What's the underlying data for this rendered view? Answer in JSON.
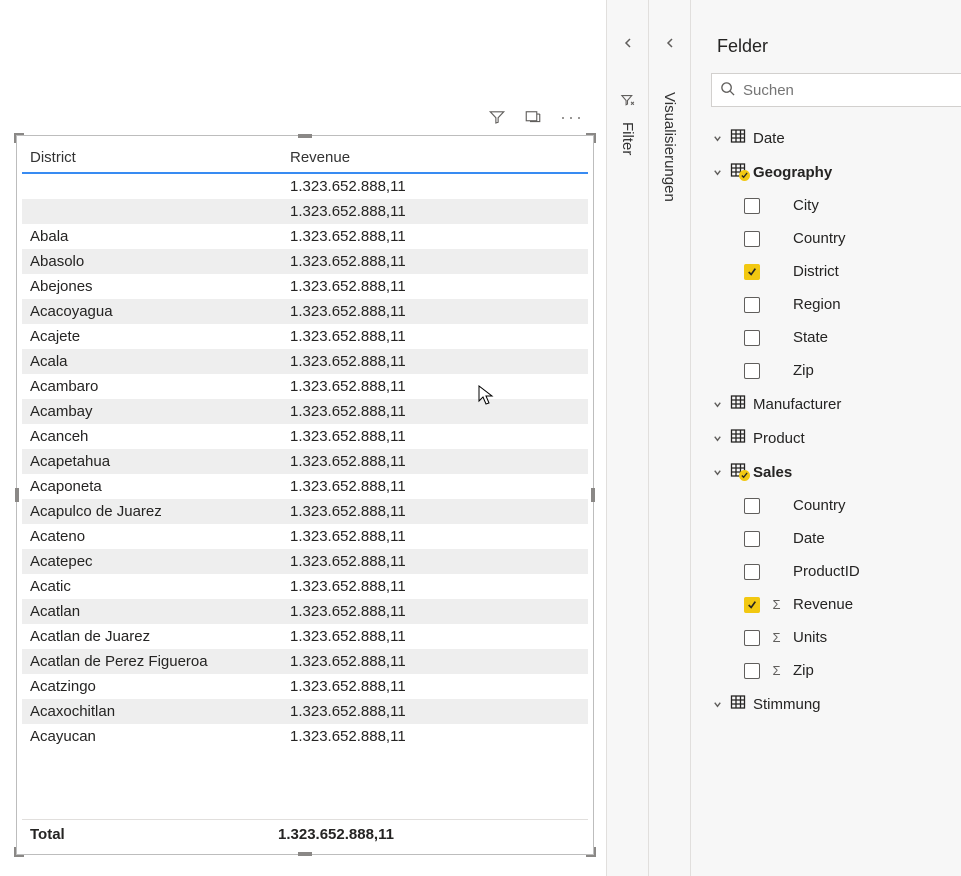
{
  "table": {
    "headers": {
      "district": "District",
      "revenue": "Revenue"
    },
    "rows": [
      {
        "district": "",
        "revenue": "1.323.652.888,11"
      },
      {
        "district": "",
        "revenue": "1.323.652.888,11"
      },
      {
        "district": "Abala",
        "revenue": "1.323.652.888,11"
      },
      {
        "district": "Abasolo",
        "revenue": "1.323.652.888,11"
      },
      {
        "district": "Abejones",
        "revenue": "1.323.652.888,11"
      },
      {
        "district": "Acacoyagua",
        "revenue": "1.323.652.888,11"
      },
      {
        "district": "Acajete",
        "revenue": "1.323.652.888,11"
      },
      {
        "district": "Acala",
        "revenue": "1.323.652.888,11"
      },
      {
        "district": "Acambaro",
        "revenue": "1.323.652.888,11"
      },
      {
        "district": "Acambay",
        "revenue": "1.323.652.888,11"
      },
      {
        "district": "Acanceh",
        "revenue": "1.323.652.888,11"
      },
      {
        "district": "Acapetahua",
        "revenue": "1.323.652.888,11"
      },
      {
        "district": "Acaponeta",
        "revenue": "1.323.652.888,11"
      },
      {
        "district": "Acapulco de Juarez",
        "revenue": "1.323.652.888,11"
      },
      {
        "district": "Acateno",
        "revenue": "1.323.652.888,11"
      },
      {
        "district": "Acatepec",
        "revenue": "1.323.652.888,11"
      },
      {
        "district": "Acatic",
        "revenue": "1.323.652.888,11"
      },
      {
        "district": "Acatlan",
        "revenue": "1.323.652.888,11"
      },
      {
        "district": "Acatlan de Juarez",
        "revenue": "1.323.652.888,11"
      },
      {
        "district": "Acatlan de Perez Figueroa",
        "revenue": "1.323.652.888,11"
      },
      {
        "district": "Acatzingo",
        "revenue": "1.323.652.888,11"
      },
      {
        "district": "Acaxochitlan",
        "revenue": "1.323.652.888,11"
      },
      {
        "district": "Acayucan",
        "revenue": "1.323.652.888,11"
      }
    ],
    "total": {
      "label": "Total",
      "revenue": "1.323.652.888,11"
    }
  },
  "panes": {
    "filters": "Filter",
    "visualizations": "Visualisierungen",
    "fields_title": "Felder",
    "search_placeholder": "Suchen"
  },
  "tables": [
    {
      "name": "Date",
      "expanded": false,
      "marked": false,
      "fields": []
    },
    {
      "name": "Geography",
      "expanded": true,
      "marked": true,
      "fields": [
        {
          "name": "City",
          "checked": false,
          "sigma": false
        },
        {
          "name": "Country",
          "checked": false,
          "sigma": false
        },
        {
          "name": "District",
          "checked": true,
          "sigma": false
        },
        {
          "name": "Region",
          "checked": false,
          "sigma": false
        },
        {
          "name": "State",
          "checked": false,
          "sigma": false
        },
        {
          "name": "Zip",
          "checked": false,
          "sigma": false
        }
      ]
    },
    {
      "name": "Manufacturer",
      "expanded": false,
      "marked": false,
      "fields": []
    },
    {
      "name": "Product",
      "expanded": false,
      "marked": false,
      "fields": []
    },
    {
      "name": "Sales",
      "expanded": true,
      "marked": true,
      "fields": [
        {
          "name": "Country",
          "checked": false,
          "sigma": false
        },
        {
          "name": "Date",
          "checked": false,
          "sigma": false
        },
        {
          "name": "ProductID",
          "checked": false,
          "sigma": false
        },
        {
          "name": "Revenue",
          "checked": true,
          "sigma": true
        },
        {
          "name": "Units",
          "checked": false,
          "sigma": true
        },
        {
          "name": "Zip",
          "checked": false,
          "sigma": true
        }
      ]
    },
    {
      "name": "Stimmung",
      "expanded": false,
      "marked": false,
      "fields": []
    }
  ]
}
